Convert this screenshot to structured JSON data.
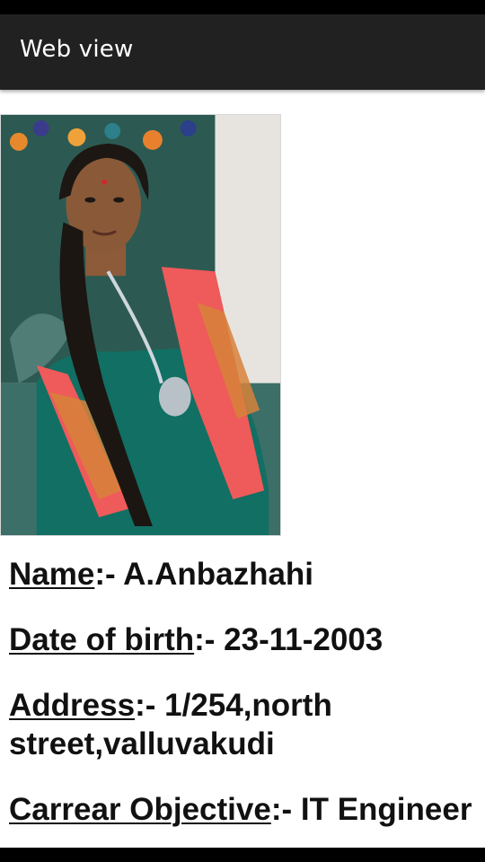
{
  "app_bar": {
    "title": "Web view"
  },
  "profile_photo": {
    "alt": "profile-photo"
  },
  "details": {
    "name": {
      "label": "Name",
      "sep": ":- ",
      "value": "A.Anbazhahi"
    },
    "dob": {
      "label": "Date of birth",
      "sep": ":- ",
      "value": "23-11-2003"
    },
    "address": {
      "label": "Address",
      "sep": ":- ",
      "value": "1/254,north street,valluvakudi"
    },
    "objective": {
      "label": "Carrear Objective",
      "sep": ":- ",
      "value": "IT Engineer"
    }
  }
}
